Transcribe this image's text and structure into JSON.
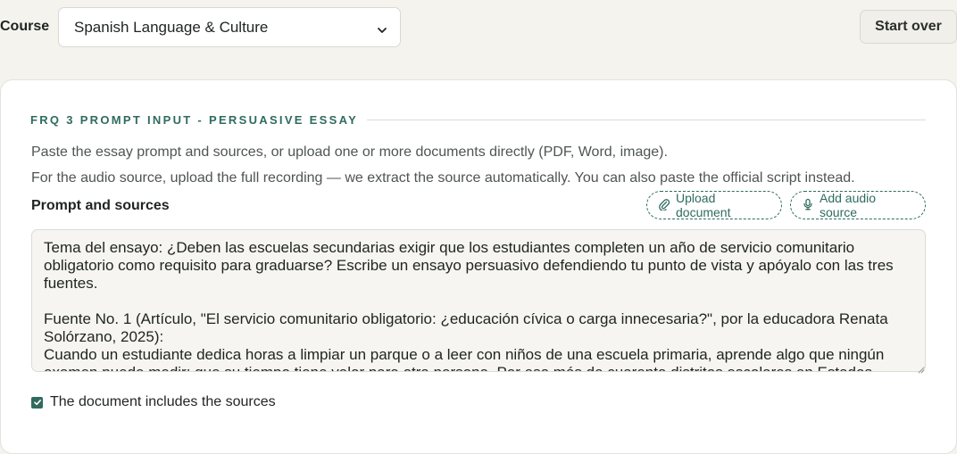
{
  "header": {
    "course_label": "Course",
    "course_selected": "Spanish Language & Culture",
    "start_over_label": "Start over"
  },
  "section": {
    "title": "FRQ 3 PROMPT INPUT - PERSUASIVE ESSAY",
    "help_line_1": "Paste the essay prompt and sources, or upload one or more documents directly (PDF, Word, image).",
    "help_line_2": "For the audio source, upload the full recording — we extract the source automatically. You can also paste the official script instead."
  },
  "prompt_field": {
    "label": "Prompt and sources",
    "upload_button": "Upload document",
    "audio_button": "Add audio source",
    "value": "Tema del ensayo: ¿Deben las escuelas secundarias exigir que los estudiantes completen un año de servicio comunitario obligatorio como requisito para graduarse? Escribe un ensayo persuasivo defendiendo tu punto de vista y apóyalo con las tres fuentes.\n\nFuente No. 1 (Artículo, \"El servicio comunitario obligatorio: ¿educación cívica o carga innecesaria?\", por la educadora Renata Solórzano, 2025):\nCuando un estudiante dedica horas a limpiar un parque o a leer con niños de una escuela primaria, aprende algo que ningún examen puede medir: que su tiempo tiene valor para otra persona. Por eso más de cuarenta distritos escolares en Estados"
  },
  "options": {
    "includes_sources_label": "The document includes the sources",
    "includes_sources_checked": true
  },
  "colors": {
    "accent": "#2f6b5e",
    "background": "#f4f3ee",
    "card": "#ffffff"
  },
  "icons": {
    "select": "chevron-down-icon",
    "upload": "paperclip-icon",
    "audio": "microphone-icon",
    "checkbox": "checkmark-icon"
  }
}
